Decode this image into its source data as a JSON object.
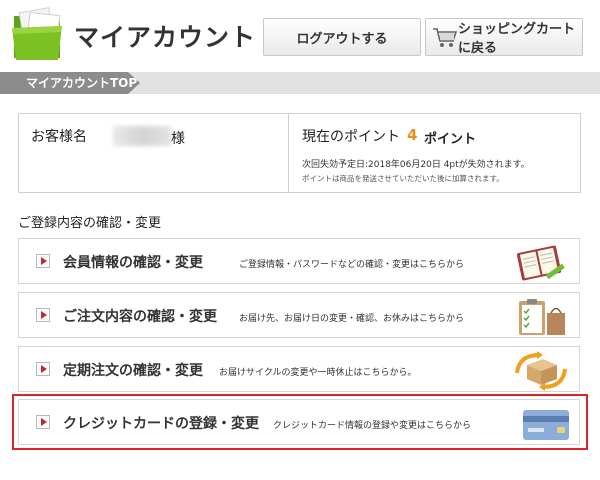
{
  "header": {
    "title": "マイアカウント",
    "logout_label": "ログアウトする",
    "cart_label": "ショッピングカートに戻る"
  },
  "breadcrumb": {
    "current": "マイアカウントTOP"
  },
  "account": {
    "customer_label": "お客様名",
    "honorific": "様",
    "points_label": "現在のポイント",
    "points_value": "4",
    "points_unit": "ポイント",
    "expiry_text": "次回失効予定日:2018年06月20日 4ptが失効されます。",
    "points_note": "ポイントは商品を発送させていただいた後に加算されます。"
  },
  "section": {
    "title": "ご登録内容の確認・変更"
  },
  "menu": [
    {
      "label": "会員情報の確認・変更",
      "description": "ご登録情報・パスワードなどの確認・変更はこちらから",
      "icon": "notebook-icon"
    },
    {
      "label": "ご注文内容の確認・変更",
      "description": "お届け先、お届け日の変更・確認、お休みはこちらから",
      "icon": "clipboard-bag-icon"
    },
    {
      "label": "定期注文の確認・変更",
      "description": "お届けサイクルの変更や一時休止はこちらから。",
      "icon": "box-cycle-icon"
    },
    {
      "label": "クレジットカードの登録・変更",
      "description": "クレジットカード情報の登録や変更はこちらから",
      "icon": "credit-card-icon",
      "highlighted": true
    }
  ],
  "colors": {
    "accent_orange": "#e8911b",
    "arrow_red": "#c0282d",
    "highlight_red": "#d8262b",
    "breadcrumb_gray": "#8c8c8c",
    "logo_green": "#7cc224"
  }
}
